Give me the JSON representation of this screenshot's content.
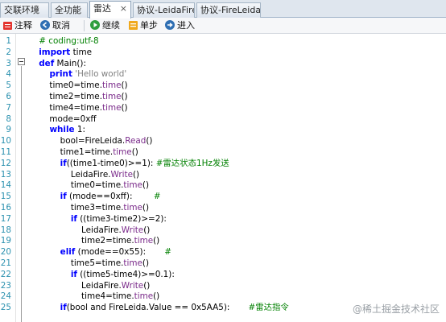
{
  "tabs": [
    {
      "label": "交联环境"
    },
    {
      "label": "全功能"
    },
    {
      "label": "雷达",
      "close": "×"
    },
    {
      "label": "协议-LeidaFire"
    },
    {
      "label": "协议-FireLeida"
    }
  ],
  "toolbar": {
    "comment": "注释",
    "cancel": "取消",
    "continue": "继续",
    "step": "单步",
    "enter": "进入"
  },
  "code_lines": [
    {
      "n": "1",
      "t": "    # coding:utf-8"
    },
    {
      "n": "2",
      "t": "    import time"
    },
    {
      "n": "3",
      "t": "    def Main():"
    },
    {
      "n": "4",
      "t": "        print 'Hello world'"
    },
    {
      "n": "5",
      "t": "        time0=time.time()"
    },
    {
      "n": "6",
      "t": "        time2=time.time()"
    },
    {
      "n": "7",
      "t": "        time4=time.time()"
    },
    {
      "n": "8",
      "t": "        mode=0xff"
    },
    {
      "n": "9",
      "t": "        while 1:"
    },
    {
      "n": "10",
      "t": "            bool=FireLeida.Read()"
    },
    {
      "n": "11",
      "t": "            time1=time.time()"
    },
    {
      "n": "12",
      "t": "            if((time1-time0)>=1): #雷达状态1Hz发送"
    },
    {
      "n": "13",
      "t": "                LeidaFire.Write()"
    },
    {
      "n": "14",
      "t": "                time0=time.time()"
    },
    {
      "n": "15",
      "t": "            if (mode==0xff):        #"
    },
    {
      "n": "16",
      "t": "                time3=time.time()"
    },
    {
      "n": "17",
      "t": "                if ((time3-time2)>=2):"
    },
    {
      "n": "18",
      "t": "                    LeidaFire.Write()"
    },
    {
      "n": "19",
      "t": "                    time2=time.time()"
    },
    {
      "n": "20",
      "t": "            elif (mode==0x55):       #"
    },
    {
      "n": "21",
      "t": "                time5=time.time()"
    },
    {
      "n": "22",
      "t": "                if ((time5-time4)>=0.1):"
    },
    {
      "n": "23",
      "t": "                    LeidaFire.Write()"
    },
    {
      "n": "24",
      "t": "                    time4=time.time()"
    },
    {
      "n": "25",
      "t": "            if(bool and FireLeida.Value == 0x5AA5):       #雷达指令"
    }
  ],
  "watermark": "@稀土掘金技术社区",
  "colors": {
    "keyword": "#0000ff",
    "function": "#7a2a8a",
    "comment": "#008000",
    "line_number": "#2b91af"
  }
}
